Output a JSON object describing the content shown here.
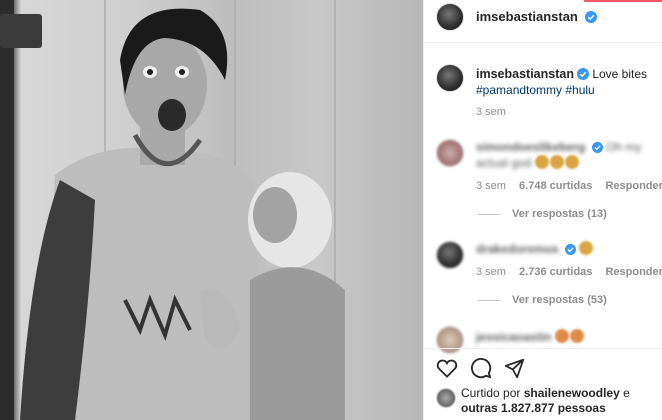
{
  "post": {
    "username": "imsebastianstan",
    "caption": "Love bites",
    "hashtags": "#pamandtommy #hulu",
    "time": "3 sem"
  },
  "comments": [
    {
      "username": "simondoeslikeberg",
      "text": "Oh my actual god",
      "time": "3 sem",
      "likes": "6.748 curtidas",
      "reply_label": "Responder",
      "view_replies": "Ver respostas (13)"
    },
    {
      "username": "drakedoremus",
      "time": "3 sem",
      "likes": "2.736 curtidas",
      "reply_label": "Responder",
      "view_replies": "Ver respostas (53)"
    },
    {
      "username": "jessicaoastin"
    }
  ],
  "likes_summary": {
    "prefix": "Curtido por",
    "user": "shailenewoodley",
    "connector": "e",
    "others": "outras 1.827.877 pessoas"
  },
  "icons": [
    "heart-icon",
    "comment-icon",
    "share-icon",
    "verified-icon"
  ],
  "colors": {
    "verified": "#3897f0",
    "link": "#00376b",
    "muted": "#8e8e8e",
    "text": "#262626"
  }
}
